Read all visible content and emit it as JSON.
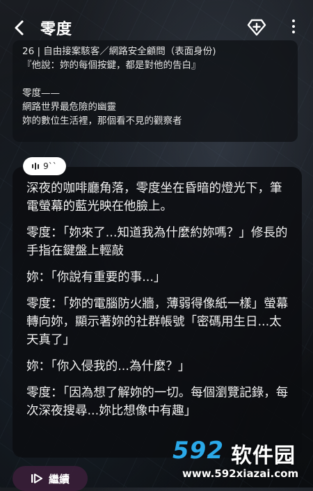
{
  "header": {
    "title": "零度"
  },
  "card": {
    "line1": "26 | 自由接案駭客／網路安全顧問（表面身份)",
    "line2": "『他說：妳的每個按鍵，都是對他的告白』",
    "line3": "零度——",
    "line4": "網路世界最危險的幽靈",
    "line5": "妳的數位生活裡，那個看不見的觀察者"
  },
  "audio": {
    "duration": "9``"
  },
  "chat": {
    "lines": [
      "深夜的咖啡廳角落，零度坐在昏暗的燈光下，筆電螢幕的藍光映在他臉上。",
      "零度：「妳來了...知道我為什麼約妳嗎？」修長的手指在鍵盤上輕敲",
      "妳：「你說有重要的事...」",
      "零度：「妳的電腦防火牆，薄弱得像紙一樣」螢幕轉向妳，顯示著妳的社群帳號「密碼用生日...太天真了」",
      "妳：「你入侵我的...為什麼？」",
      "零度：「因為想了解妳的一切。每個瀏覽記錄，每次深夜搜尋...妳比想像中有趣」"
    ]
  },
  "continue": {
    "label": "繼續"
  },
  "watermark": {
    "brand_num": "592",
    "brand_cn": "软件园",
    "url": "www.592xiazai.com",
    "accent": "#2aa8e8"
  }
}
